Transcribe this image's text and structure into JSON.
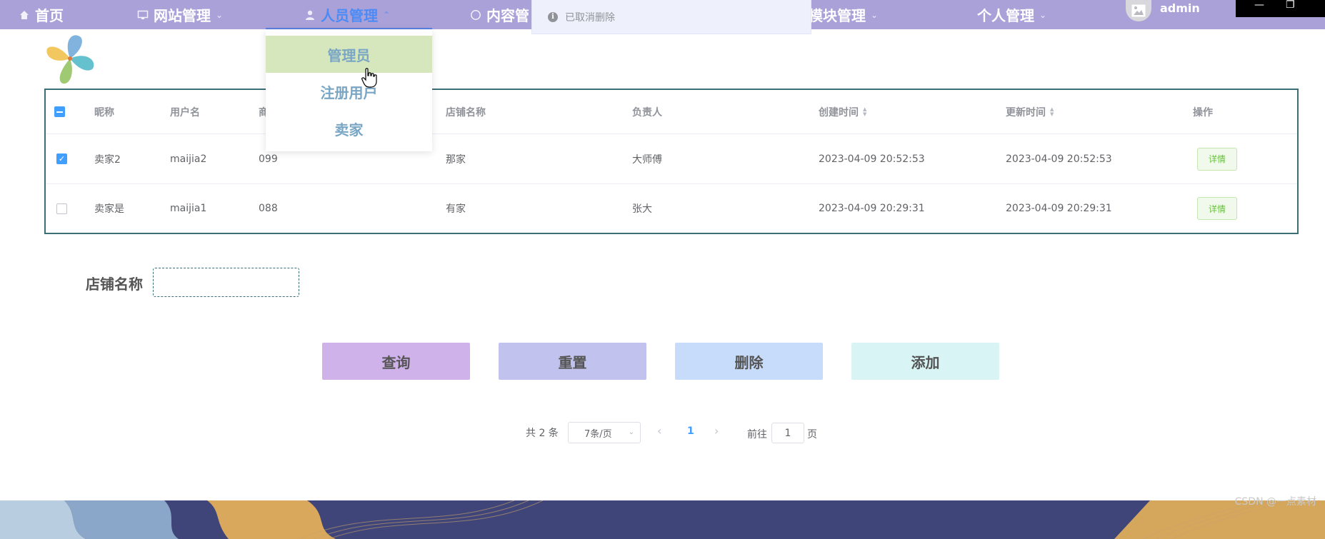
{
  "nav": {
    "items": [
      {
        "label": "首页",
        "icon": "home-icon"
      },
      {
        "label": "网站管理",
        "icon": "monitor-icon"
      },
      {
        "label": "人员管理",
        "icon": "user-icon"
      },
      {
        "label": "内容管",
        "icon": "message-icon"
      },
      {
        "label": "模块管理",
        "icon": ""
      },
      {
        "label": "个人管理",
        "icon": ""
      }
    ],
    "user": "admin",
    "active_color": "#4a8bf5",
    "bg_color": "#aaa1d9"
  },
  "dropdown": {
    "items": [
      "管理员",
      "注册用户",
      "卖家"
    ],
    "hover_index": 0
  },
  "toast": {
    "message": "已取消删除",
    "icon": "info-icon"
  },
  "table": {
    "columns": [
      "昵称",
      "用户名",
      "商",
      "店铺名称",
      "负责人",
      "创建时间",
      "更新时间",
      "操作"
    ],
    "rows": [
      {
        "checked": true,
        "nickname": "卖家2",
        "username": "maijia2",
        "col3": "099",
        "shop": "那家",
        "owner": "大师傅",
        "created": "2023-04-09 20:52:53",
        "updated": "2023-04-09 20:52:53",
        "action": "详情"
      },
      {
        "checked": false,
        "nickname": "卖家是",
        "username": "maijia1",
        "col3": "088",
        "shop": "有家",
        "owner": "张大",
        "created": "2023-04-09 20:29:31",
        "updated": "2023-04-09 20:29:31",
        "action": "详情"
      }
    ]
  },
  "search": {
    "label": "店铺名称",
    "value": "",
    "placeholder": ""
  },
  "actions": {
    "query": "查询",
    "reset": "重置",
    "delete": "删除",
    "add": "添加"
  },
  "pagination": {
    "total": "共 2 条",
    "page_size": "7条/页",
    "current": "1",
    "goto_label": "前往",
    "goto_value": "1",
    "page_suffix": "页"
  },
  "watermark": "CSDN @一点素材"
}
